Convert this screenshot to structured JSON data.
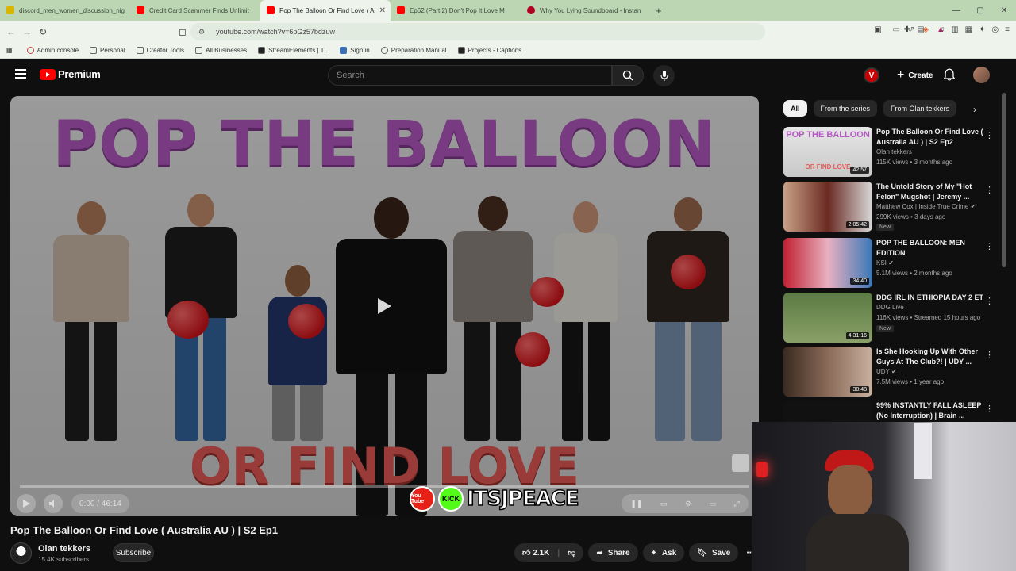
{
  "browser": {
    "tabs": [
      {
        "label": "discord_men_women_discussion_nig",
        "color": "#d9b400",
        "active": false
      },
      {
        "label": "Credit Card Scammer Finds Unlimit",
        "color": "#ff0000",
        "active": false
      },
      {
        "label": "Pop The Balloon Or Find Love ( A",
        "color": "#ff0000",
        "active": true
      },
      {
        "label": "Ep62 (Part 2) Don't Pop It Love M",
        "color": "#ff0000",
        "active": false
      },
      {
        "label": "Why You Lying Soundboard - Instan",
        "color": "#b00020",
        "active": false
      }
    ],
    "url": "youtube.com/watch?v=6pGz57bdzuw",
    "bookmarks": [
      "Admin console",
      "Personal",
      "Creator Tools",
      "All Businesses",
      "StreamElements | T...",
      "Sign in",
      "Preparation Manual",
      "Projects - Captions"
    ]
  },
  "youtube": {
    "logo_text": "Premium",
    "search_placeholder": "Search",
    "account_initial": "V",
    "create_label": "Create"
  },
  "player": {
    "thumb_title_top": "POP THE BALLOON",
    "thumb_title_bottom": "OR FIND LOVE",
    "time": "0:00 / 46:14",
    "watermark_yt": "You Tube",
    "watermark_kick": "KICK",
    "watermark_name": "ITSJPEACE"
  },
  "video": {
    "title": "Pop The Balloon Or Find Love ( Australia AU ) | S2 Ep1",
    "channel": "Olan tekkers",
    "subscribers": "15.4K subscribers",
    "subscribe_label": "Subscribe",
    "likes": "2.1K",
    "share_label": "Share",
    "ask_label": "Ask",
    "save_label": "Save"
  },
  "chips": [
    "All",
    "From the series",
    "From Olan tekkers"
  ],
  "recommendations": [
    {
      "title": "Pop The Balloon Or Find Love ( Australia AU ) | S2 Ep2",
      "channel": "Olan tekkers",
      "meta": "115K views • 3 months ago",
      "duration": "42:57",
      "badge": "",
      "thumb": "#d8c4dc"
    },
    {
      "title": "The Untold Story of My \"Hot Felon\" Mugshot | Jeremy ...",
      "channel": "Matthew Cox | Inside True Crime",
      "meta": "299K views • 3 days ago",
      "duration": "2:05:42",
      "badge": "New",
      "thumb": "#a33a2a"
    },
    {
      "title": "POP THE BALLOON: MEN EDITION",
      "channel": "KSI",
      "meta": "5.1M views • 2 months ago",
      "duration": "34:40",
      "badge": "",
      "thumb": "#d03040"
    },
    {
      "title": "DDG IRL IN ETHIOPIA DAY 2 ET",
      "channel": "DDG Live",
      "meta": "116K views • Streamed 15 hours ago",
      "duration": "4:31:16",
      "badge": "New",
      "thumb": "#5c7a44"
    },
    {
      "title": "Is She Hooking Up With Other Guys At The Club?! | UDY ...",
      "channel": "UDY",
      "meta": "7.5M views • 1 year ago",
      "duration": "38:48",
      "badge": "",
      "thumb": "#6a5648"
    },
    {
      "title": "99% INSTANTLY FALL ASLEEP (No Interruption) | Brain ...",
      "channel": "",
      "meta": "",
      "duration": "",
      "badge": "",
      "thumb": "#111111"
    }
  ]
}
